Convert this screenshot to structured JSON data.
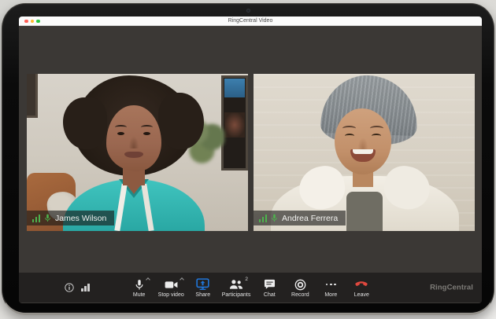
{
  "window": {
    "title": "RingCentral Video",
    "controls": {
      "close": "close",
      "minimize": "minimize",
      "zoom": "zoom"
    }
  },
  "participants": [
    {
      "name": "James Wilson",
      "signal_icon": "signal-bars",
      "mic_icon": "microphone-on"
    },
    {
      "name": "Andrea Ferrera",
      "signal_icon": "signal-bars",
      "mic_icon": "microphone-on"
    }
  ],
  "toolbar": {
    "left": {
      "info_icon": "info",
      "signal_icon": "signal-bars"
    },
    "buttons": [
      {
        "label": "Mute",
        "icon": "microphone",
        "chevron": true
      },
      {
        "label": "Stop video",
        "icon": "video-camera",
        "chevron": true
      },
      {
        "label": "Share",
        "icon": "share-screen"
      },
      {
        "label": "Participants",
        "icon": "participants",
        "badge": "2"
      },
      {
        "label": "Chat",
        "icon": "chat-bubble"
      },
      {
        "label": "Record",
        "icon": "record"
      },
      {
        "label": "More",
        "icon": "more-dots"
      },
      {
        "label": "Leave",
        "icon": "leave-call"
      }
    ],
    "brand": "RingCentral"
  },
  "colors": {
    "share_blue": "#2076d9",
    "leave_red": "#e0483e",
    "active_green": "#4db34d",
    "toolbar_bg": "#232120",
    "meeting_bg": "#3b3835"
  }
}
